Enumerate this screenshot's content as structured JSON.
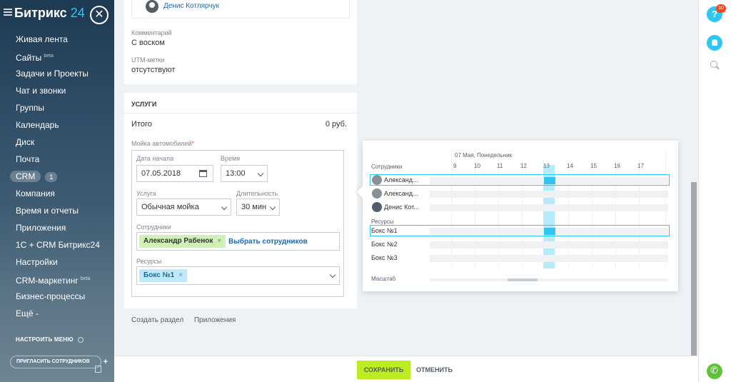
{
  "sidebar": {
    "logo_text": "Битрикс",
    "logo_num": "24",
    "menu": [
      {
        "label": "Живая лента"
      },
      {
        "label": "Сайты",
        "sup": "beta"
      },
      {
        "label": "Задачи и Проекты"
      },
      {
        "label": "Чат и звонки"
      },
      {
        "label": "Группы"
      },
      {
        "label": "Календарь"
      },
      {
        "label": "Диск"
      },
      {
        "label": "Почта"
      },
      {
        "label": "CRM",
        "count": "1"
      },
      {
        "label": "Компания"
      },
      {
        "label": "Время и отчеты"
      },
      {
        "label": "Приложения"
      },
      {
        "label": "1С + CRM Битрикс24"
      },
      {
        "label": "Настройки"
      },
      {
        "label": "CRM-маркетинг",
        "sup": "beta"
      },
      {
        "label": "Бизнес-процессы"
      },
      {
        "label": "Ещё -"
      }
    ],
    "setup_menu": "НАСТРОИТЬ МЕНЮ",
    "invite": "ПРИГЛАСИТЬ СОТРУДНИКОВ",
    "invite_plus": "+"
  },
  "form": {
    "responsible_name": "Денис Котлярчук",
    "comment_label": "Комментарий",
    "comment_value": "С воском",
    "utm_label": "UTM-метки",
    "utm_value": "отсутствуют",
    "services_title": "УСЛУГИ",
    "total_label": "Итого",
    "total_value": "0 руб.",
    "service_label": "Мойка автомобилей",
    "required_mark": "*",
    "date_label": "Дата начала",
    "date_value": "07.05.2018",
    "time_label": "Время",
    "time_value": "13:00",
    "service_field_label": "Услуга",
    "service_value": "Обычная мойка",
    "duration_label": "Длительность",
    "duration_value": "30 мин",
    "staff_label": "Сотрудники",
    "staff_tag": "Александр Рабенок",
    "staff_link": "Выбрать сотрудников",
    "resources_label": "Ресурсы",
    "resource_tag": "Бокс №1",
    "tag_x": "×",
    "bottom_links": [
      "Создать раздел",
      "Приложения"
    ]
  },
  "popup": {
    "staff_header": "Сотрудники",
    "date_header": "07 Мая, Понедельник",
    "hours": [
      "9",
      "10",
      "11",
      "12",
      "13",
      "14",
      "15",
      "16",
      "17"
    ],
    "staff_rows": [
      "Александ...",
      "Александ...",
      "Денис Кот..."
    ],
    "resources_header": "Ресурсы",
    "resource_rows": [
      "Бокс №1",
      "Бокс №2",
      "Бокс №3"
    ],
    "scale_label": "Масштаб",
    "selected_hour": "13"
  },
  "right": {
    "help_label": "?",
    "help_badge": "10"
  },
  "footer": {
    "save": "СОХРАНИТЬ",
    "cancel": "ОТМЕНИТЬ"
  },
  "colors": {
    "accent": "#2fc6f6",
    "save_green": "#bbed21",
    "link_blue": "#2067b0",
    "badge_red": "#f54819"
  }
}
